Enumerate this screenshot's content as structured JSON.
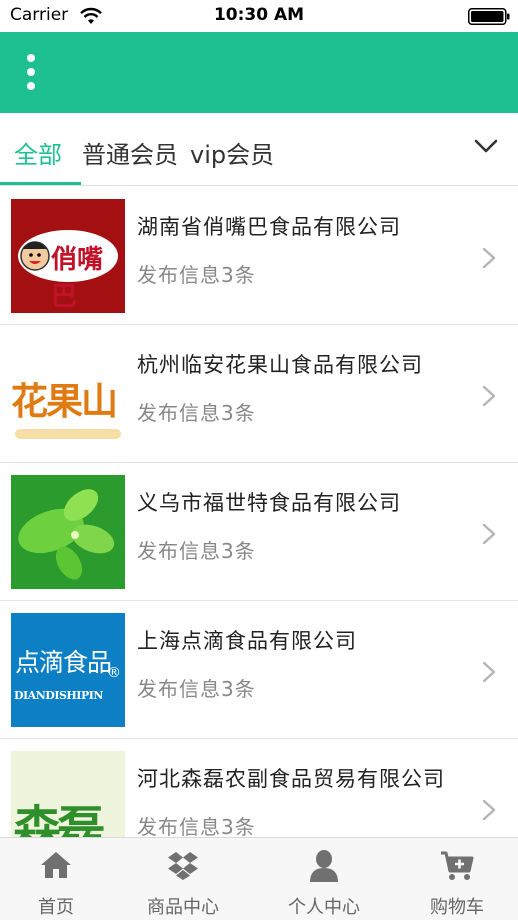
{
  "status_bar": {
    "carrier": "Carrier",
    "time": "10:30 AM"
  },
  "colors": {
    "accent": "#1ec092",
    "text": "#222222",
    "muted": "#888888"
  },
  "header": {
    "menu_icon": "more-vertical-icon"
  },
  "tabs": [
    {
      "label": "全部",
      "active": true
    },
    {
      "label": "普通会员",
      "active": false
    },
    {
      "label": "vip会员",
      "active": false
    }
  ],
  "companies": [
    {
      "name": "湖南省俏嘴巴食品有限公司",
      "info": "发布信息3条",
      "logo_text": "俏嘴巴"
    },
    {
      "name": "杭州临安花果山食品有限公司",
      "info": "发布信息3条",
      "logo_text": "花果山"
    },
    {
      "name": "义乌市福世特食品有限公司",
      "info": "发布信息3条",
      "logo_text": ""
    },
    {
      "name": "上海点滴食品有限公司",
      "info": "发布信息3条",
      "logo_text": "点滴食品",
      "logo_subtext": "DIANDISHIPIN",
      "logo_mark": "®"
    },
    {
      "name": "河北森磊农副食品贸易有限公司",
      "info": "发布信息3条",
      "logo_text": "森磊"
    }
  ],
  "tabbar": [
    {
      "label": "首页",
      "icon": "home-icon"
    },
    {
      "label": "商品中心",
      "icon": "dropbox-icon"
    },
    {
      "label": "个人中心",
      "icon": "user-icon"
    },
    {
      "label": "购物车",
      "icon": "cart-icon"
    }
  ]
}
